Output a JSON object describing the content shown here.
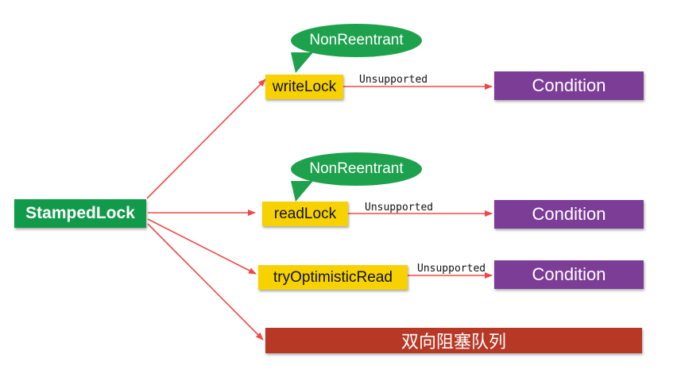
{
  "colors": {
    "root": "#109A4A",
    "lock": "#F7D200",
    "condition": "#7C3D97",
    "queue": "#B83826",
    "bubble": "#1DA14C",
    "arrow": "#F04848"
  },
  "root": {
    "label": "StampedLock"
  },
  "locks": [
    {
      "label": "writeLock",
      "bubble": "NonReentrant",
      "edge_label": "Unsupported",
      "condition": "Condition"
    },
    {
      "label": "readLock",
      "bubble": "NonReentrant",
      "edge_label": "Unsupported",
      "condition": "Condition"
    },
    {
      "label": "tryOptimisticRead",
      "edge_label": "Unsupported",
      "condition": "Condition"
    }
  ],
  "queue": {
    "label": "双向阻塞队列"
  }
}
